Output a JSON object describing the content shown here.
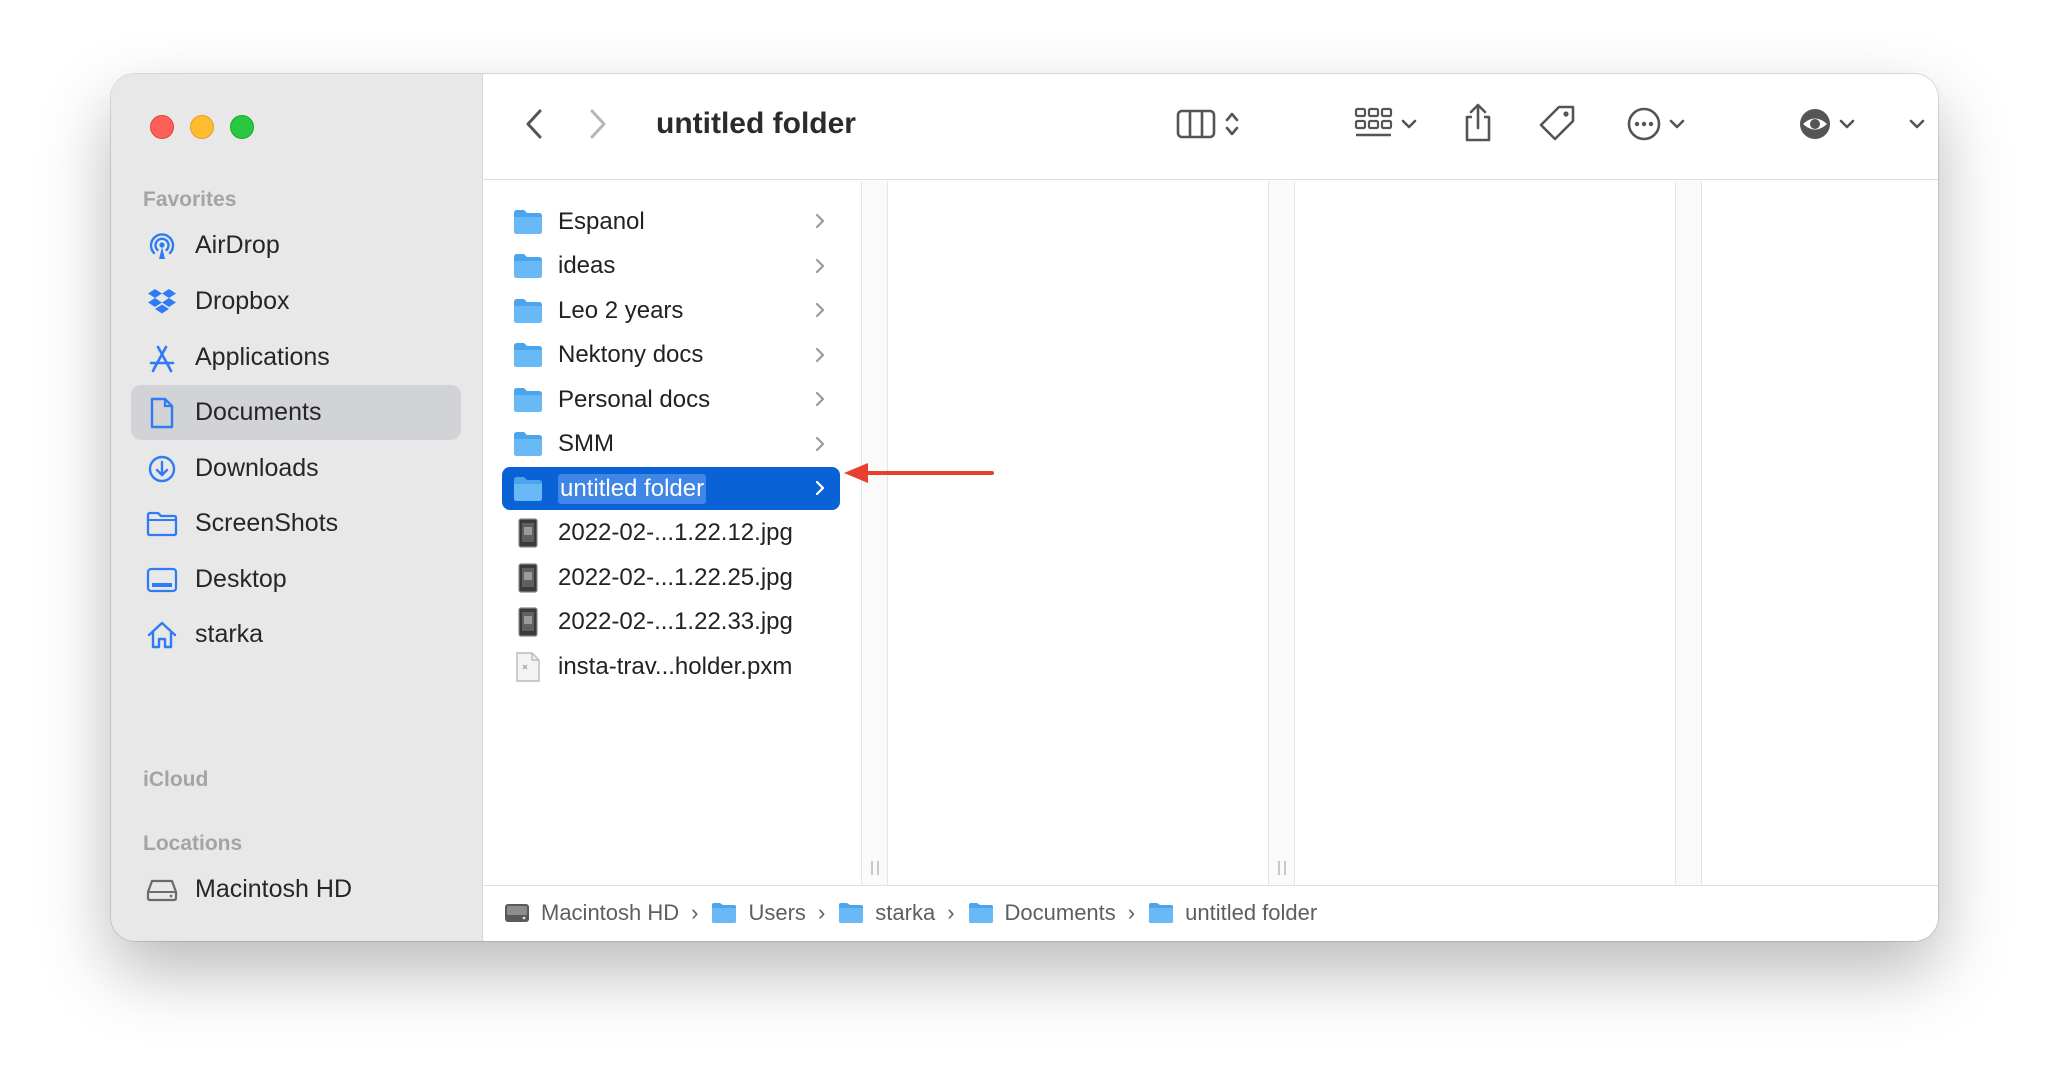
{
  "window": {
    "title": "untitled folder"
  },
  "sidebar": {
    "sections": {
      "favorites": "Favorites",
      "icloud": "iCloud",
      "locations": "Locations"
    },
    "favorites": [
      {
        "label": "AirDrop",
        "icon": "airdrop-icon"
      },
      {
        "label": "Dropbox",
        "icon": "dropbox-icon"
      },
      {
        "label": "Applications",
        "icon": "applications-icon"
      },
      {
        "label": "Documents",
        "icon": "document-icon",
        "selected": true
      },
      {
        "label": "Downloads",
        "icon": "download-icon"
      },
      {
        "label": "ScreenShots",
        "icon": "folder-icon"
      },
      {
        "label": "Desktop",
        "icon": "desktop-icon"
      },
      {
        "label": "starka",
        "icon": "home-icon"
      }
    ],
    "locations": [
      {
        "label": "Macintosh HD",
        "icon": "drive-icon"
      }
    ]
  },
  "toolbar": {
    "back_icon": "chevron-left-icon",
    "forward_icon": "chevron-right-icon",
    "view_icon": "columns-view-icon",
    "group_icon": "grid-group-icon",
    "share_icon": "share-icon",
    "tag_icon": "tag-icon",
    "more_icon": "ellipsis-circle-icon",
    "preview_icon": "eye-icon",
    "search_icon": "search-icon"
  },
  "files": [
    {
      "name": "Espanol",
      "type": "folder"
    },
    {
      "name": "ideas",
      "type": "folder"
    },
    {
      "name": "Leo 2 years",
      "type": "folder"
    },
    {
      "name": "Nektony docs",
      "type": "folder"
    },
    {
      "name": "Personal docs",
      "type": "folder"
    },
    {
      "name": "SMM",
      "type": "folder"
    },
    {
      "name": "untitled folder",
      "type": "folder",
      "selected": true
    },
    {
      "name": "2022-02-...1.22.12.jpg",
      "type": "image"
    },
    {
      "name": "2022-02-...1.22.25.jpg",
      "type": "image"
    },
    {
      "name": "2022-02-...1.22.33.jpg",
      "type": "image"
    },
    {
      "name": "insta-trav...holder.pxm",
      "type": "document"
    }
  ],
  "pathbar": [
    "Macintosh HD",
    "Users",
    "starka",
    "Documents",
    "untitled folder"
  ],
  "colors": {
    "selection": "#0a63d6",
    "sidebar_icon": "#2f7bf5",
    "folder": "#61b4f5",
    "annotation_arrow": "#e8402e"
  }
}
